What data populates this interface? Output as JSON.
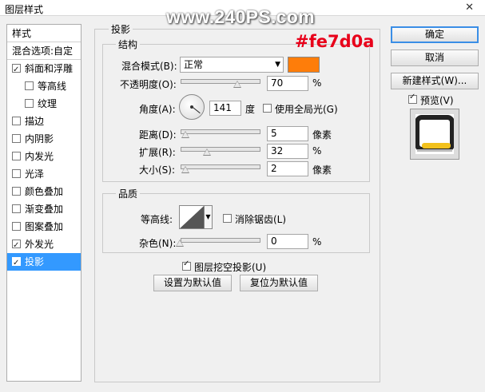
{
  "window": {
    "title": "图层样式",
    "close": "✕"
  },
  "watermark": "www.240PS.com",
  "annotation": {
    "hex": "#fe7d0a"
  },
  "stylelist": {
    "head": "样式",
    "blend": "混合选项:自定",
    "items": [
      {
        "label": "斜面和浮雕",
        "checked": true
      },
      {
        "label": "等高线",
        "checked": false
      },
      {
        "label": "纹理",
        "checked": false
      },
      {
        "label": "描边",
        "checked": false
      },
      {
        "label": "内阴影",
        "checked": false
      },
      {
        "label": "内发光",
        "checked": false
      },
      {
        "label": "光泽",
        "checked": false
      },
      {
        "label": "颜色叠加",
        "checked": false
      },
      {
        "label": "渐变叠加",
        "checked": false
      },
      {
        "label": "图案叠加",
        "checked": false
      },
      {
        "label": "外发光",
        "checked": true
      },
      {
        "label": "投影",
        "checked": true
      }
    ]
  },
  "panel": {
    "title": "投影",
    "structure": {
      "title": "结构",
      "blend_mode_label": "混合模式(B):",
      "blend_mode_value": "正常",
      "color": "#fe7d0a",
      "opacity_label": "不透明度(O):",
      "opacity_value": "70",
      "opacity_unit": "%",
      "angle_label": "角度(A):",
      "angle_value": "141",
      "angle_unit": "度",
      "global_light_label": "使用全局光(G)",
      "distance_label": "距离(D):",
      "distance_value": "5",
      "distance_unit": "像素",
      "spread_label": "扩展(R):",
      "spread_value": "32",
      "spread_unit": "%",
      "size_label": "大小(S):",
      "size_value": "2",
      "size_unit": "像素"
    },
    "quality": {
      "title": "品质",
      "contour_label": "等高线:",
      "antialias_label": "消除锯齿(L)",
      "noise_label": "杂色(N):",
      "noise_value": "0",
      "noise_unit": "%"
    },
    "knockout_label": "图层挖空投影(U)",
    "make_default": "设置为默认值",
    "reset_default": "复位为默认值"
  },
  "buttons": {
    "ok": "确定",
    "cancel": "取消",
    "new_style": "新建样式(W)...",
    "preview_label": "预览(V)"
  }
}
